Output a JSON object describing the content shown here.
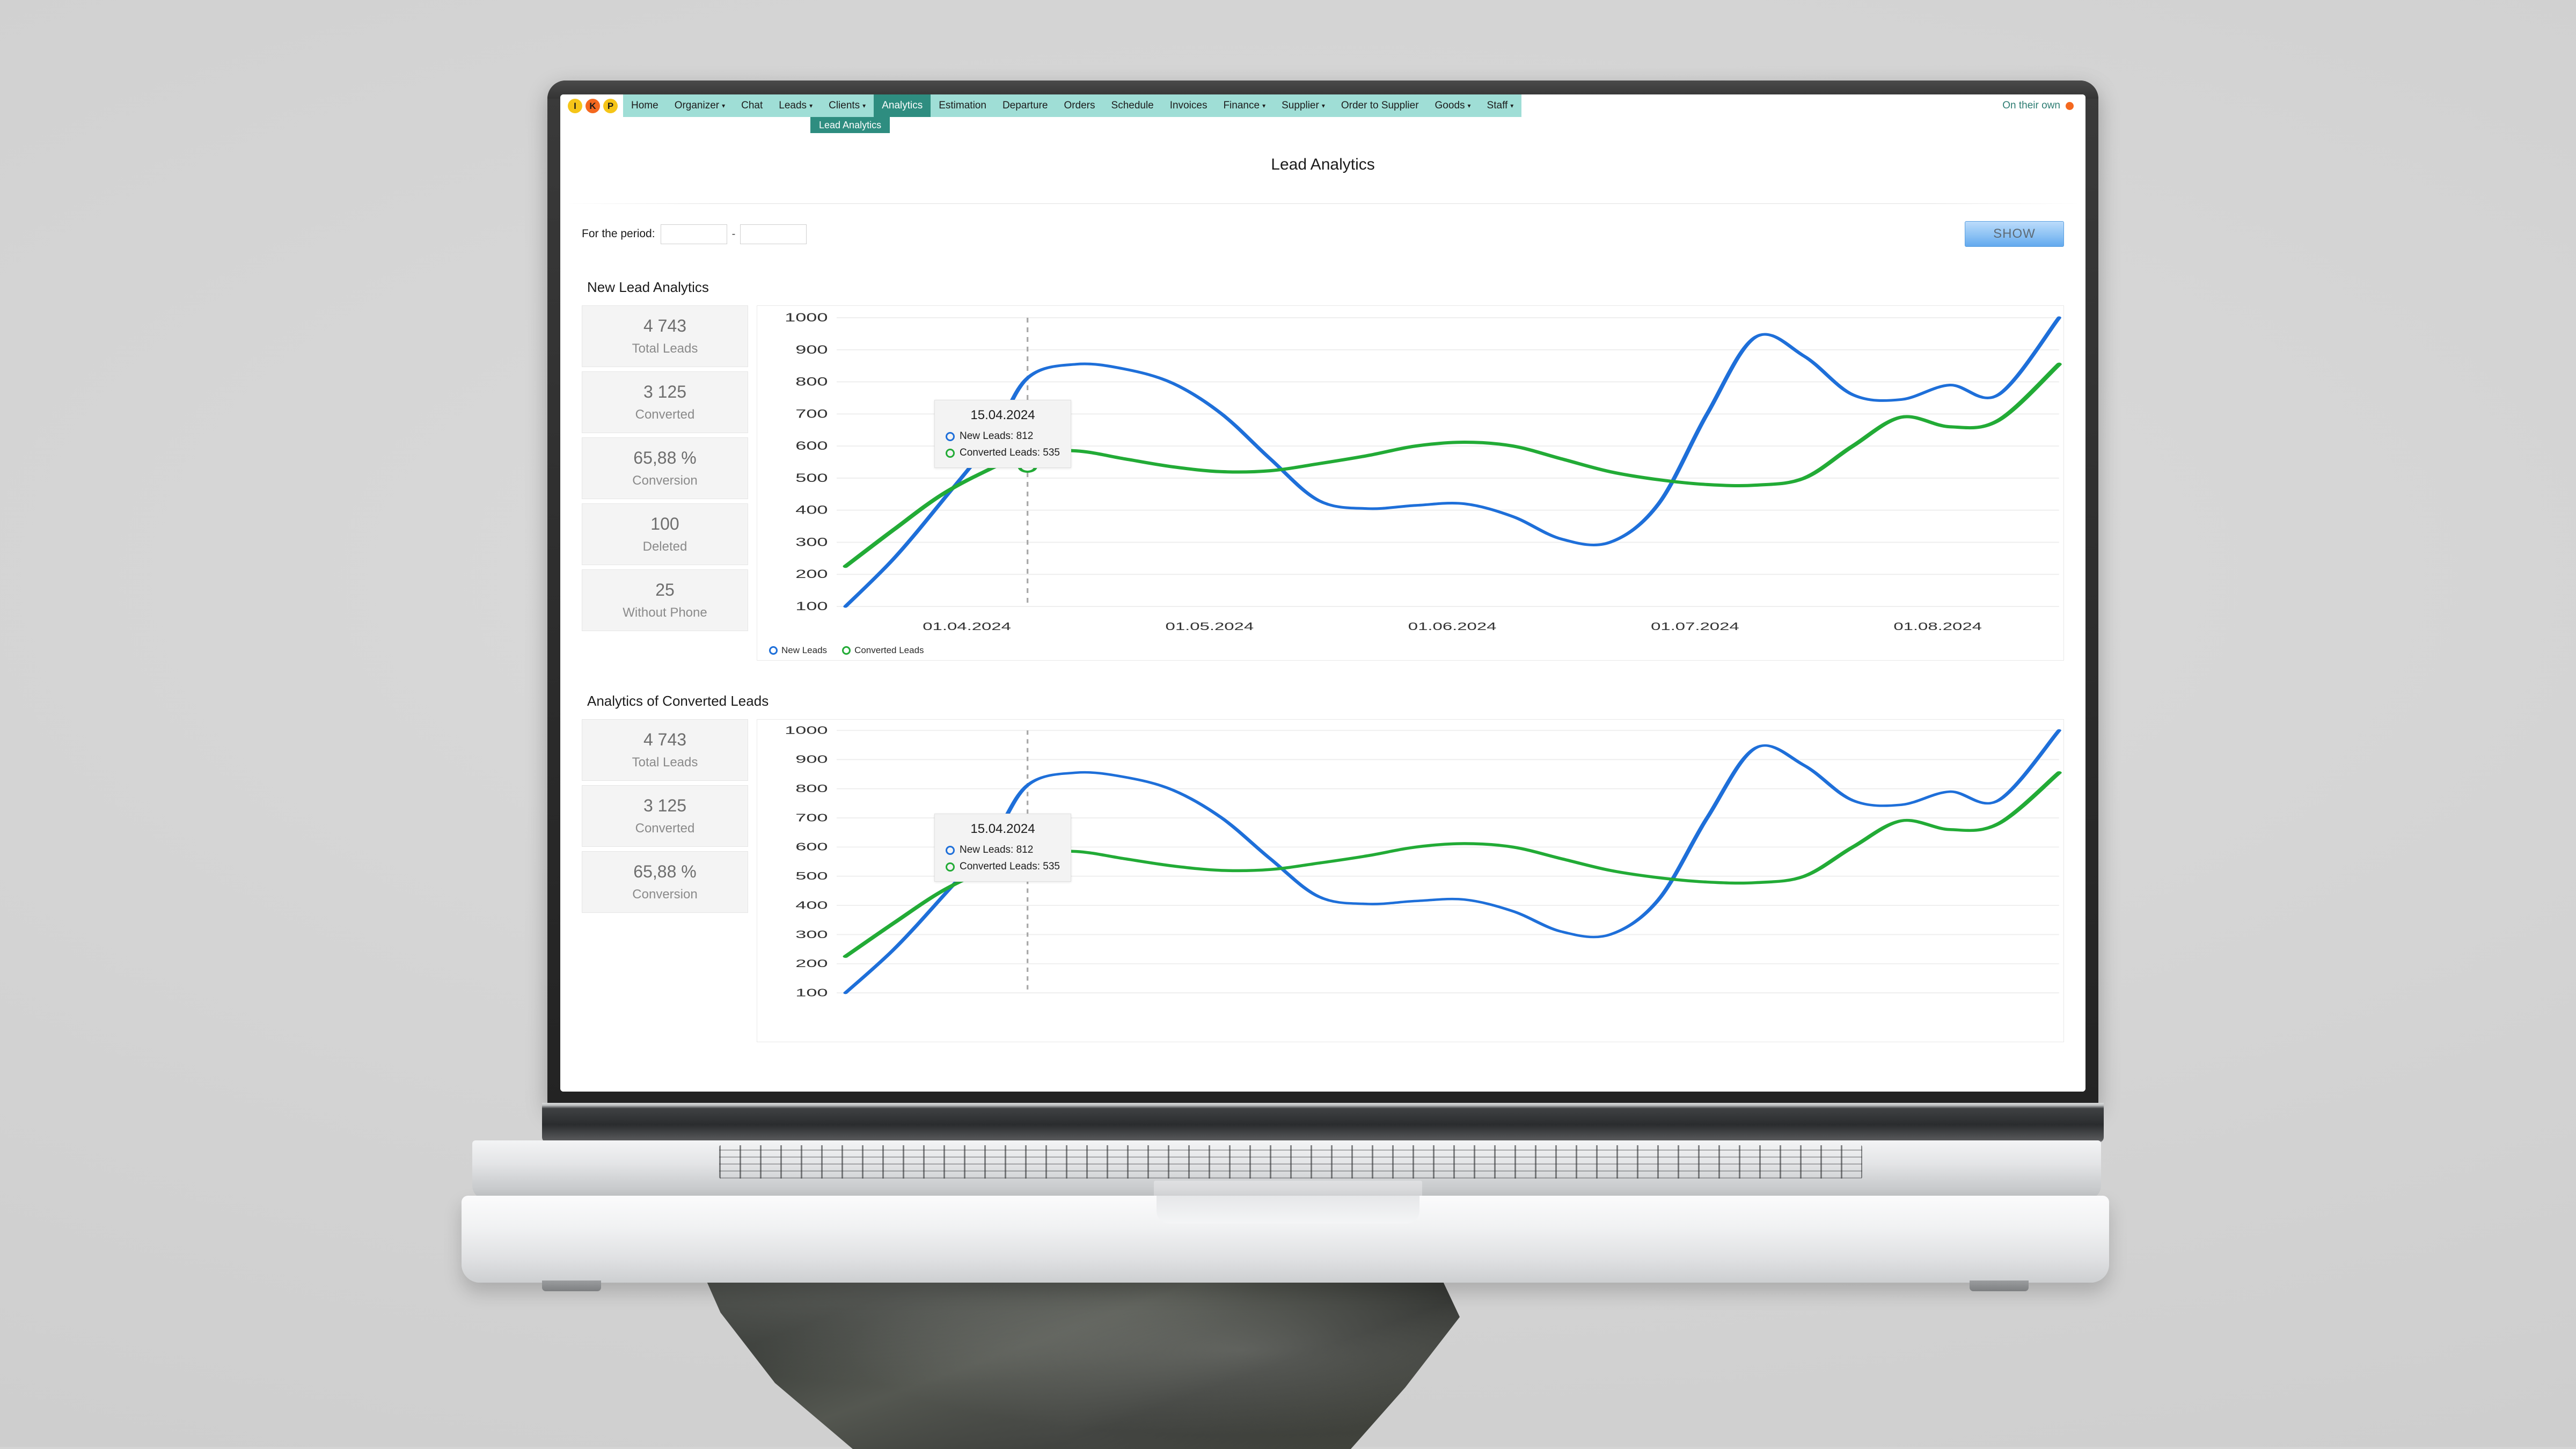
{
  "browser": {
    "profile_dots": [
      {
        "letter": "I",
        "color": "#f5c518"
      },
      {
        "letter": "K",
        "color": "#f4681f"
      },
      {
        "letter": "P",
        "color": "#f5c518"
      }
    ]
  },
  "nav": {
    "items": [
      {
        "label": "Home",
        "caret": false,
        "active": false
      },
      {
        "label": "Organizer",
        "caret": true,
        "active": false
      },
      {
        "label": "Chat",
        "caret": false,
        "active": false
      },
      {
        "label": "Leads",
        "caret": true,
        "active": false
      },
      {
        "label": "Clients",
        "caret": true,
        "active": false
      },
      {
        "label": "Analytics",
        "caret": false,
        "active": true
      },
      {
        "label": "Estimation",
        "caret": false,
        "active": false
      },
      {
        "label": "Departure",
        "caret": false,
        "active": false
      },
      {
        "label": "Orders",
        "caret": false,
        "active": false
      },
      {
        "label": "Schedule",
        "caret": false,
        "active": false
      },
      {
        "label": "Invoices",
        "caret": false,
        "active": false
      },
      {
        "label": "Finance",
        "caret": true,
        "active": false
      },
      {
        "label": "Supplier",
        "caret": true,
        "active": false
      },
      {
        "label": "Order to Supplier",
        "caret": false,
        "active": false
      },
      {
        "label": "Goods",
        "caret": true,
        "active": false
      },
      {
        "label": "Staff",
        "caret": true,
        "active": false
      }
    ],
    "right_link": "On their own",
    "submenu_item": "Lead Analytics",
    "accent": "#2e8d80",
    "bar_color": "#9fded6"
  },
  "page": {
    "title": "Lead Analytics"
  },
  "filter": {
    "label": "For the period:",
    "date_from": "",
    "date_to": "",
    "separator": "-",
    "show_button": "SHOW"
  },
  "sections": [
    {
      "title": "New Lead Analytics",
      "stats": [
        {
          "value": "4 743",
          "label": "Total Leads"
        },
        {
          "value": "3 125",
          "label": "Converted"
        },
        {
          "value": "65,88 %",
          "label": "Conversion"
        },
        {
          "value": "100",
          "label": "Deleted"
        },
        {
          "value": "25",
          "label": "Without Phone"
        }
      ]
    },
    {
      "title": "Analytics of Converted Leads",
      "stats": [
        {
          "value": "4 743",
          "label": "Total Leads"
        },
        {
          "value": "3 125",
          "label": "Converted"
        },
        {
          "value": "65,88 %",
          "label": "Conversion"
        }
      ]
    }
  ],
  "tooltip": {
    "date": "15.04.2024",
    "rows": [
      {
        "label": "New Leads: 812",
        "color": "#1e6fd9"
      },
      {
        "label": "Converted Leads: 535",
        "color": "#22ab36"
      }
    ]
  },
  "chart_data": {
    "type": "line",
    "title": "New Lead Analytics",
    "xlabel": "",
    "ylabel": "",
    "ylim": [
      100,
      1000
    ],
    "yticks": [
      100,
      200,
      300,
      400,
      500,
      600,
      700,
      800,
      900,
      1000
    ],
    "xticks": [
      "01.04.2024",
      "01.05.2024",
      "01.06.2024",
      "01.07.2024",
      "01.08.2024"
    ],
    "grid": true,
    "legend_position": "bottom-left",
    "legend": [
      "New Leads",
      "Converted Leads"
    ],
    "colors": {
      "new_leads": "#1e6fd9",
      "converted_leads": "#22ab36"
    },
    "x": [
      0,
      4,
      8,
      12,
      15,
      19,
      23,
      27,
      31,
      35,
      39,
      43,
      47,
      51,
      55,
      59,
      63,
      67,
      71,
      75,
      79,
      83,
      87,
      91,
      95,
      100
    ],
    "series": [
      {
        "name": "New Leads",
        "values": [
          100,
          250,
          430,
          620,
          812,
          855,
          840,
          795,
          700,
          560,
          430,
          405,
          415,
          420,
          380,
          310,
          300,
          420,
          700,
          940,
          880,
          760,
          745,
          790,
          760,
          1000
        ]
      },
      {
        "name": "Converted Leads",
        "values": [
          225,
          340,
          450,
          530,
          578,
          585,
          560,
          535,
          520,
          523,
          545,
          570,
          600,
          612,
          600,
          560,
          520,
          495,
          480,
          478,
          500,
          600,
          690,
          660,
          680,
          855
        ]
      }
    ],
    "highlight": {
      "x_label": "15.04.2024",
      "new_leads": 812,
      "converted_leads": 535
    }
  }
}
